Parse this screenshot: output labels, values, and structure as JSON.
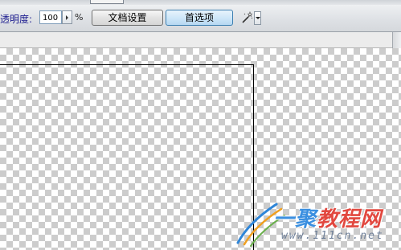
{
  "toolbar": {
    "opacity_label": "不透明度:",
    "opacity_value": "100",
    "percent_sign": "%",
    "document_settings_button": "文档设置",
    "preferences_button": "首选项",
    "tool_icon": "magic-wand-icon"
  },
  "watermark": {
    "title_part1": "一聚",
    "title_part2": "教程网",
    "url": "www.111cn.net"
  },
  "colors": {
    "label_text": "#1d1d8f",
    "preferences_highlight": "#cfe7f8",
    "checker_gray": "#cccccc",
    "checker_white": "#ffffff"
  }
}
